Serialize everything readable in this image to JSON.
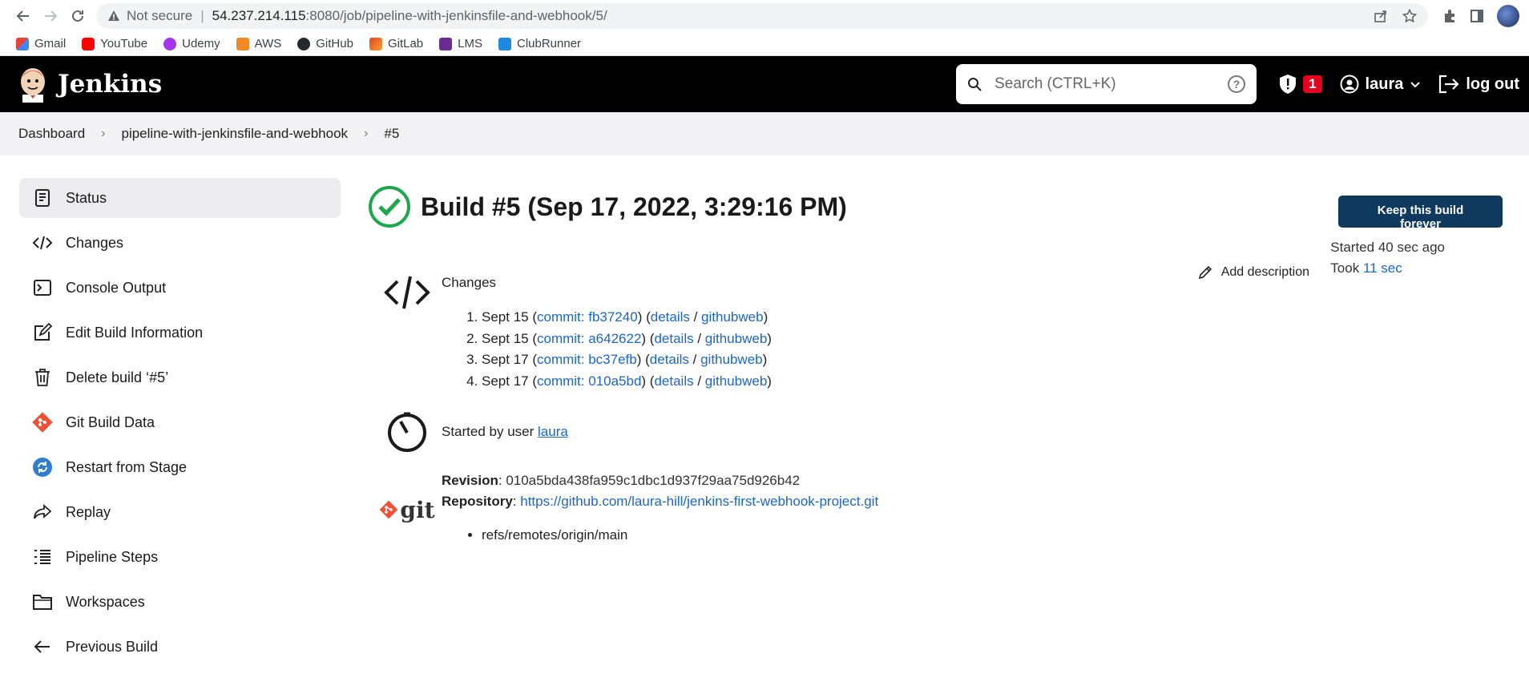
{
  "browser": {
    "not_secure": "Not secure",
    "url_host": "54.237.214.115",
    "url_path": ":8080/job/pipeline-with-jenkinsfile-and-webhook/5/",
    "bookmarks": [
      "Gmail",
      "YouTube",
      "Udemy",
      "AWS",
      "GitHub",
      "GitLab",
      "LMS",
      "ClubRunner"
    ]
  },
  "header": {
    "brand": "Jenkins",
    "search_placeholder": "Search (CTRL+K)",
    "security_count": "1",
    "user": "laura",
    "logout": "log out"
  },
  "breadcrumb": [
    "Dashboard",
    "pipeline-with-jenkinsfile-and-webhook",
    "#5"
  ],
  "sidebar": {
    "items": [
      {
        "label": "Status",
        "icon": "status-icon"
      },
      {
        "label": "Changes",
        "icon": "code-icon"
      },
      {
        "label": "Console Output",
        "icon": "terminal-icon"
      },
      {
        "label": "Edit Build Information",
        "icon": "edit-icon"
      },
      {
        "label": "Delete build ‘#5’",
        "icon": "trash-icon"
      },
      {
        "label": "Git Build Data",
        "icon": "git-icon"
      },
      {
        "label": "Restart from Stage",
        "icon": "restart-icon"
      },
      {
        "label": "Replay",
        "icon": "replay-icon"
      },
      {
        "label": "Pipeline Steps",
        "icon": "list-icon"
      },
      {
        "label": "Workspaces",
        "icon": "folder-icon"
      },
      {
        "label": "Previous Build",
        "icon": "arrow-left-icon"
      }
    ]
  },
  "build": {
    "title": "Build #5 (Sep 17, 2022, 3:29:16 PM)",
    "keep_forever": "Keep this build forever",
    "started": "Started 40 sec ago",
    "took_prefix": "Took",
    "took_value": "11 sec",
    "add_description": "Add description"
  },
  "changes": {
    "heading": "Changes",
    "items": [
      {
        "date": "Sept 15",
        "commit": "commit: fb37240",
        "details": "details",
        "web": "githubweb"
      },
      {
        "date": "Sept 15",
        "commit": "commit: a642622",
        "details": "details",
        "web": "githubweb"
      },
      {
        "date": "Sept 17",
        "commit": "commit: bc37efb",
        "details": "details",
        "web": "githubweb"
      },
      {
        "date": "Sept 17",
        "commit": "commit: 010a5bd",
        "details": "details",
        "web": "githubweb"
      }
    ]
  },
  "started_by": {
    "prefix": "Started by user",
    "user": "laura"
  },
  "git": {
    "logo_text": "git",
    "revision_label": "Revision",
    "revision": "010a5bda438fa959c1dbc1d937f29aa75d926b42",
    "repository_label": "Repository",
    "repository": "https://github.com/laura-hill/jenkins-first-webhook-project.git",
    "refs": [
      "refs/remotes/origin/main"
    ]
  },
  "colors": {
    "success": "#1ea64b",
    "link": "#1a66c9",
    "keep_button": "#0f3a5e",
    "badge": "#e6001f"
  }
}
